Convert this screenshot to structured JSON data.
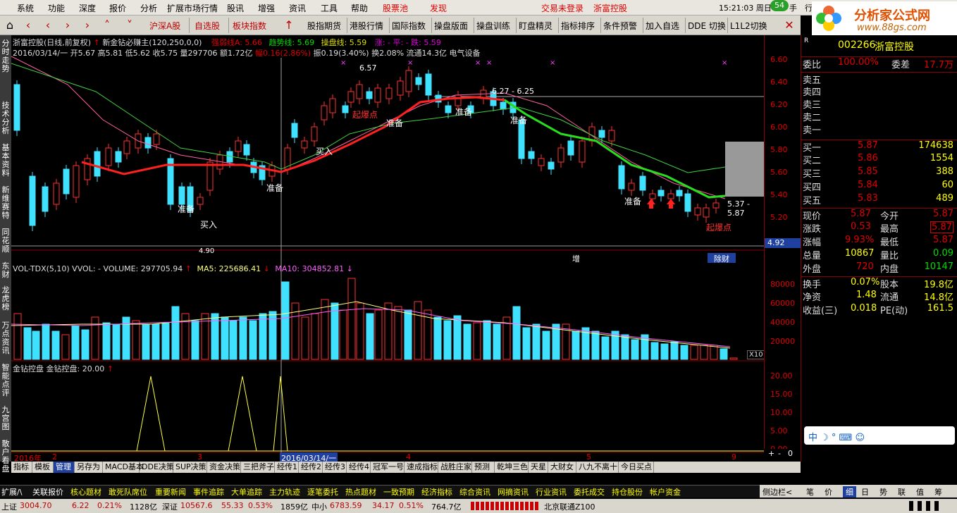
{
  "menu": {
    "items": [
      "系统",
      "功能",
      "深度",
      "报价",
      "分析",
      "扩展市场行情",
      "股讯",
      "增强",
      "资讯",
      "工具",
      "帮助"
    ],
    "stockpool": "股票池",
    "discover": "发现",
    "login": "交易未登录",
    "stock_name": "浙富控股",
    "time": "15:21:03 周日",
    "badge": "54",
    "tail1": "行",
    "tail2": "手"
  },
  "toolbar": {
    "items": [
      "沪深A股",
      "自选股",
      "板块指数",
      "股指期货",
      "港股行情",
      "国际指数",
      "操盘版面",
      "操盘训练",
      "盯盘精灵",
      "指标排序",
      "条件预警",
      "加入自选",
      "DDE 切换",
      "L1L2切换"
    ]
  },
  "logo": {
    "title": "分析家公式网",
    "url": "www.88gs.com"
  },
  "leftstrip": [
    "分时走势",
    "技术分析",
    "基本资料",
    "新维赛特",
    "同花顺",
    "东财",
    "龙虎榜",
    "万点资讯",
    "智能点评",
    "九宫图",
    "散户看盘"
  ],
  "chart": {
    "header1": "浙富控股(日线,前复权)",
    "header1b": "新金钻必赚主(120,250,0,0)",
    "header1c": "强弱线A: 5.66",
    "header1d": "趋势线: 5.69",
    "header1e": "操盘线: 5.59",
    "header1f": "涨: -  平: -  跌: 5.59",
    "header2a": "2016/03/14/一 开5.67 高5.81 低5.62 收5.75 量297706 额1.72亿",
    "header2b": "幅0.16(2.86%)",
    "header2c": "振0.19(3.40%) 换2.08% 流通14.3亿 电气设备",
    "ann": {
      "p657": "6.57",
      "range1": "6.27 - 6.25",
      "range2": "5.37 - 5.87",
      "p490": "4.90",
      "bao1": "起爆点",
      "bao2": "起爆点",
      "zb1": "准备",
      "zb2": "准备",
      "zb3": "准备",
      "zb4": "准备",
      "zb5": "准备",
      "zb6": "准备",
      "mr1": "买入",
      "mr2": "买入",
      "zeng": "增",
      "cai": "除财",
      "price": "4.92"
    },
    "vol_header_a": "VOL-TDX(5,10) VVOL: -  VOLUME: 297705.94",
    "vol_header_b": "MA5: 225686.41",
    "vol_header_c": "MA10: 304852.81",
    "vol_unit": "X10",
    "ind_header": "金钻控盘 金钻控盘: 20.00",
    "dates": {
      "y2016": "2016年",
      "m2": "2",
      "m3": "3",
      "cursor": "2016/03/14/一",
      "m4": "4",
      "m5": "5",
      "m9": "9"
    }
  },
  "chart_data": {
    "type": "candlestick",
    "price_axis": [
      6.6,
      6.4,
      6.2,
      6.0,
      5.8,
      5.6,
      5.4,
      5.2
    ],
    "volume_axis": [
      80000,
      60000,
      40000,
      20000
    ],
    "indicator_axis": [
      20.0,
      15.0,
      10.0,
      5.0,
      0.0
    ]
  },
  "quote": {
    "code": "002266",
    "name": "浙富控股",
    "weibi": {
      "l": "委比",
      "v": "100.00%",
      "l2": "委差",
      "v2": "17.7万"
    },
    "sell": [
      {
        "l": "卖五"
      },
      {
        "l": "卖四"
      },
      {
        "l": "卖三"
      },
      {
        "l": "卖二"
      },
      {
        "l": "卖一"
      }
    ],
    "buy": [
      {
        "l": "买一",
        "p": "5.87",
        "v": "174638"
      },
      {
        "l": "买二",
        "p": "5.86",
        "v": "1554"
      },
      {
        "l": "买三",
        "p": "5.85",
        "v": "388"
      },
      {
        "l": "买四",
        "p": "5.84",
        "v": "60"
      },
      {
        "l": "买五",
        "p": "5.83",
        "v": "489"
      }
    ],
    "stats": [
      {
        "l": "现价",
        "v": "5.87",
        "l2": "今开",
        "v2": "5.87"
      },
      {
        "l": "涨跌",
        "v": "0.53",
        "l2": "最高",
        "v2": "5.87"
      },
      {
        "l": "涨幅",
        "v": "9.93%",
        "l2": "最低",
        "v2": "5.87"
      },
      {
        "l": "总量",
        "v": "10867",
        "l2": "量比",
        "v2": "0.09"
      },
      {
        "l": "外盘",
        "v": "720",
        "l2": "内盘",
        "v2": "10147"
      }
    ],
    "fund": [
      {
        "l": "换手",
        "v": "0.07%",
        "l2": "股本",
        "v2": "19.8亿"
      },
      {
        "l": "净资",
        "v": "1.48",
        "l2": "流通",
        "v2": "14.8亿"
      },
      {
        "l": "收益(三)",
        "v": "0.018",
        "l2": "PE(动)",
        "v2": "161.5"
      }
    ],
    "tabs": [
      "笔",
      "价",
      "细",
      "日",
      "势",
      "联",
      "值",
      "筹"
    ],
    "daylabel": "日线"
  },
  "bottomtabs": [
    "指标",
    "模板",
    "管理",
    "另存为",
    "MACD基本",
    "DDE决策",
    "SUP决策",
    "资金决策",
    "三把斧子",
    "经传1",
    "经传2",
    "经传3",
    "经传4",
    "冠军一号",
    "速成指标",
    "战胜庄家",
    "预测",
    "乾坤三色",
    "天星",
    "大财女",
    "八九不离十",
    "今日买点"
  ],
  "bottomtabs2": [
    "扩展/\\",
    "关联报价",
    "核心题材",
    "敢死队席位",
    "重要新闻",
    "事件追踪",
    "大单追踪",
    "主力轨迹",
    "逐笔委托",
    "热点题材",
    "一致预期",
    "经济指标",
    "综合资讯",
    "网摘资讯",
    "行业资讯",
    "委托成交",
    "持仓股份",
    "帐户资金"
  ],
  "status": {
    "sh_l": "上证",
    "sh_v": "3004.70",
    "sh_c": "6.22",
    "sh_p": "0.21%",
    "sh_a": "1128亿",
    "sz_l": "深证",
    "sz_v": "10567.6",
    "sz_c": "55.33",
    "sz_p": "0.53%",
    "sz_a": "1859亿",
    "zx_l": "中小",
    "zx_v": "6783.59",
    "zx_c": "34.17",
    "zx_p": "0.51%",
    "zx_a": "764.7亿",
    "server": "北京联通Z100",
    "side": "侧边栏<"
  }
}
